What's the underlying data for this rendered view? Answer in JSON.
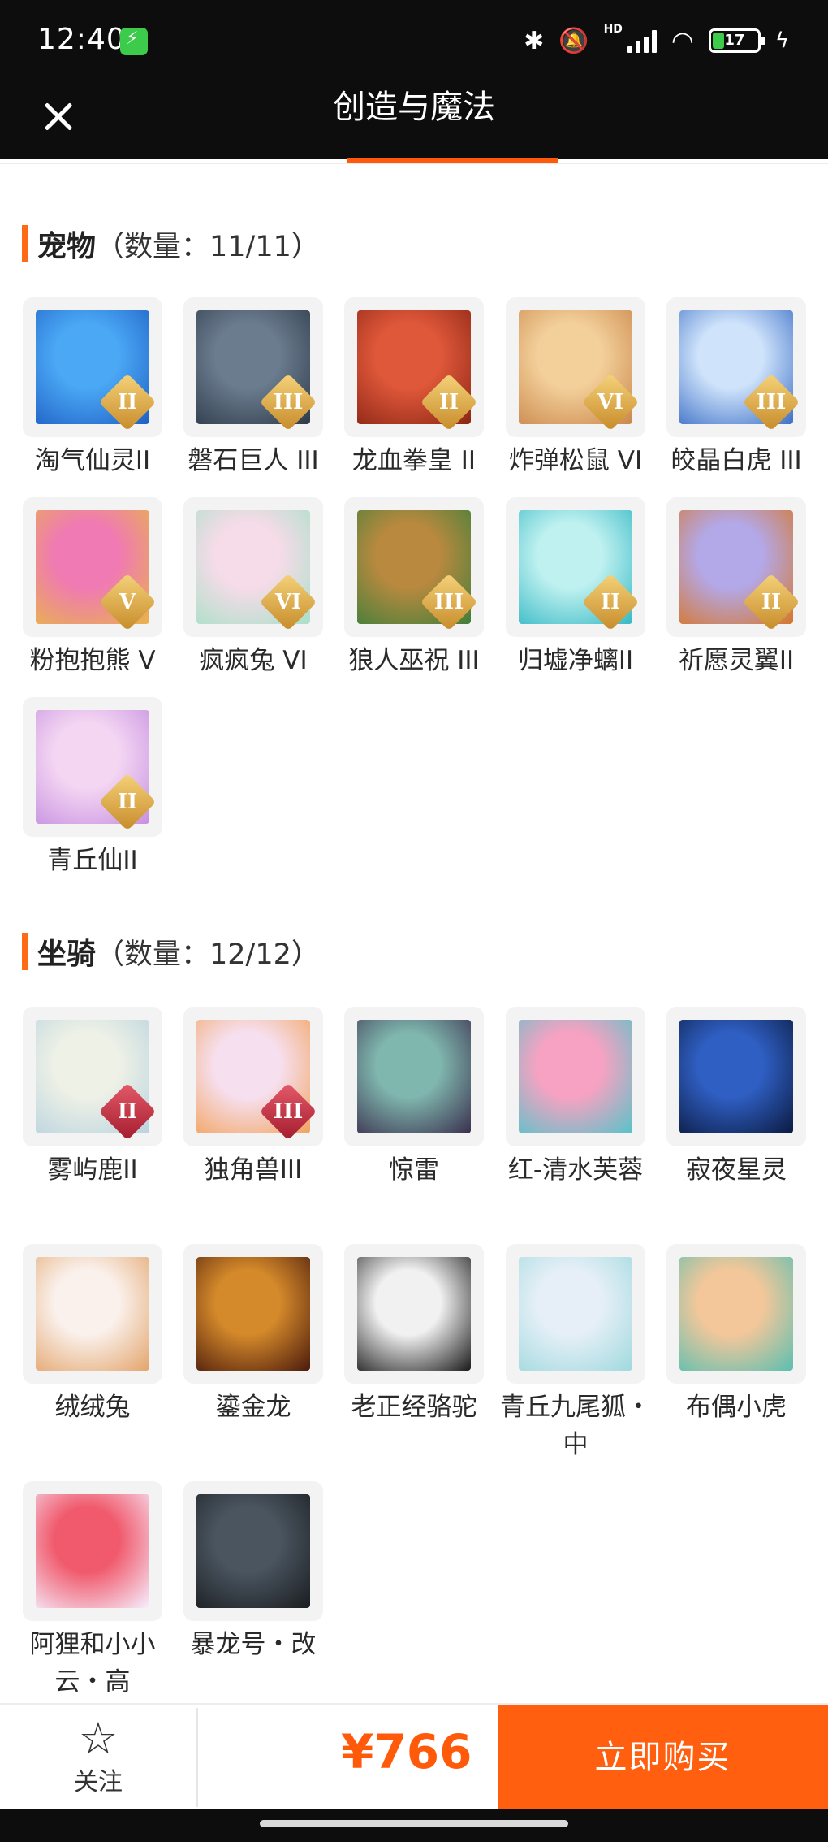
{
  "status": {
    "time": "12:40",
    "battery": "17",
    "network": "HD"
  },
  "header": {
    "title": "创造与魔法"
  },
  "pets": {
    "name": "宠物",
    "count": "（数量：11/11）",
    "items": [
      {
        "label": "淘气仙灵II",
        "badge": "II",
        "colors": [
          "#4aa8f5",
          "#1f5fc4"
        ]
      },
      {
        "label": "磐石巨人 III",
        "badge": "III",
        "colors": [
          "#6b7c8f",
          "#2d3a48"
        ]
      },
      {
        "label": "龙血拳皇 II",
        "badge": "II",
        "colors": [
          "#e0583a",
          "#8a2514"
        ]
      },
      {
        "label": "炸弹松鼠 VI",
        "badge": "VI",
        "colors": [
          "#f3cf9a",
          "#c9874a"
        ]
      },
      {
        "label": "皎晶白虎 III",
        "badge": "III",
        "colors": [
          "#cfe3fb",
          "#3b6fc6"
        ]
      },
      {
        "label": "粉抱抱熊 V",
        "badge": "V",
        "colors": [
          "#f07ab3",
          "#e8b44a"
        ]
      },
      {
        "label": "疯疯兔 VI",
        "badge": "VI",
        "colors": [
          "#f6dbe8",
          "#a8e0c8"
        ]
      },
      {
        "label": "狼人巫祝 III",
        "badge": "III",
        "colors": [
          "#b8893f",
          "#3e7f3a"
        ]
      },
      {
        "label": "归墟净螭II",
        "badge": "II",
        "colors": [
          "#bff1f0",
          "#35b8c4"
        ]
      },
      {
        "label": "祈愿灵翼II",
        "badge": "II",
        "colors": [
          "#b3a8e8",
          "#d7762a"
        ]
      },
      {
        "label": "青丘仙II",
        "badge": "II",
        "colors": [
          "#f4d6f3",
          "#c68fe0"
        ]
      }
    ]
  },
  "mounts": {
    "name": "坐骑",
    "count": "（数量：12/12）",
    "items": [
      {
        "label": "雾屿鹿II",
        "badge": "II",
        "colors": [
          "#eef1e6",
          "#b9d3df"
        ]
      },
      {
        "label": "独角兽III",
        "badge": "III",
        "colors": [
          "#f6e0f0",
          "#f2a25c"
        ]
      },
      {
        "label": "惊雷",
        "badge": "",
        "colors": [
          "#7fb6ad",
          "#3a2f4e"
        ]
      },
      {
        "label": "红-清水芙蓉",
        "badge": "",
        "colors": [
          "#f7a2c2",
          "#56c3c9"
        ]
      },
      {
        "label": "寂夜星灵",
        "badge": "",
        "colors": [
          "#2f5fc3",
          "#0b1a40"
        ]
      },
      {
        "label": "绒绒兔",
        "badge": "",
        "colors": [
          "#faf1ec",
          "#e3a46b"
        ]
      },
      {
        "label": "鎏金龙",
        "badge": "",
        "colors": [
          "#d4892a",
          "#4a1a0c"
        ]
      },
      {
        "label": "老正经骆驼",
        "badge": "",
        "colors": [
          "#f1f1f1",
          "#1a1a1a"
        ]
      },
      {
        "label": "青丘九尾狐・中",
        "badge": "",
        "colors": [
          "#e6eff7",
          "#9fd9de"
        ]
      },
      {
        "label": "布偶小虎",
        "badge": "",
        "colors": [
          "#f4c79a",
          "#59bfb1"
        ]
      },
      {
        "label": "阿狸和小小云・高",
        "badge": "",
        "colors": [
          "#f05a6c",
          "#f6f0ff"
        ]
      },
      {
        "label": "暴龙号・改",
        "badge": "",
        "colors": [
          "#4a5560",
          "#1a1d20"
        ]
      }
    ]
  },
  "bottom": {
    "follow_label": "关注",
    "price": "¥766",
    "buy_label": "立即购买"
  }
}
